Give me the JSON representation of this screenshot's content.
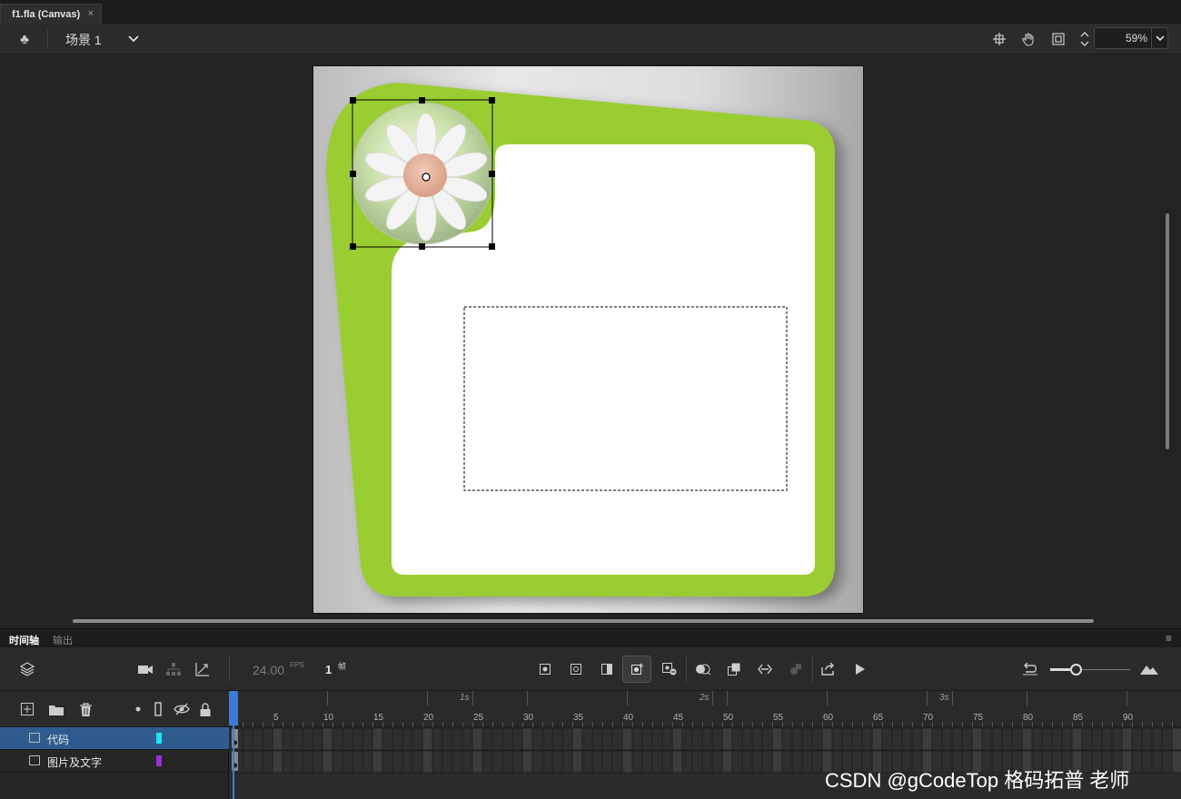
{
  "document": {
    "tab_title": "f1.fla (Canvas)",
    "close_glyph": "×"
  },
  "edit_bar": {
    "scene_label": "场景 1",
    "zoom": "59%"
  },
  "timeline": {
    "tabs": [
      "时间轴",
      "输出"
    ],
    "fps_value": "24.00",
    "fps_unit": "FPS",
    "frame_value": "1",
    "frame_unit": "帧",
    "seconds": [
      "1s",
      "2s",
      "3s"
    ],
    "ticks": [
      "5",
      "10",
      "15",
      "20",
      "25",
      "30",
      "35",
      "40",
      "45",
      "50",
      "55",
      "60",
      "65",
      "70",
      "75",
      "80",
      "85",
      "90"
    ],
    "layers": [
      {
        "name": "代码",
        "color": "#1de4f5",
        "selected": true
      },
      {
        "name": "图片及文字",
        "color": "#9b2fd6",
        "selected": false
      }
    ]
  },
  "watermark": "CSDN @gCodeTop  格码拓普 老师",
  "colors": {
    "frame_green": "#9acd32",
    "selection_blue": "#2e5c8e",
    "playhead": "#3c7ad6"
  }
}
